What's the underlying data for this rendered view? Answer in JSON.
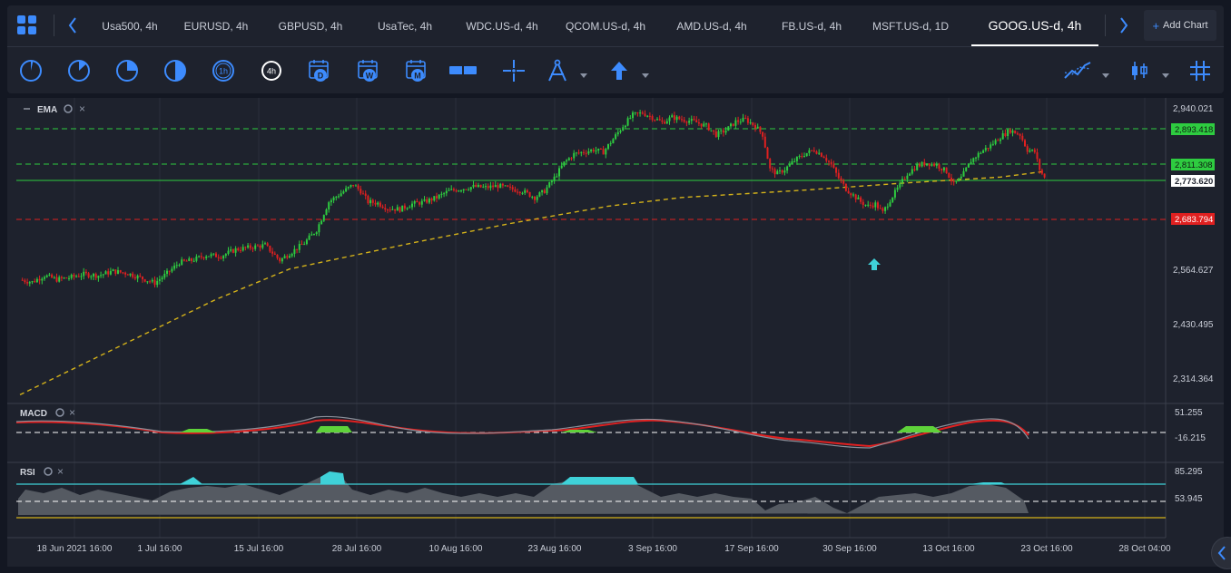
{
  "tabs": [
    {
      "label": "Usa500, 4h",
      "active": false
    },
    {
      "label": "EURUSD, 4h",
      "active": false
    },
    {
      "label": "GBPUSD, 4h",
      "active": false
    },
    {
      "label": "UsaTec, 4h",
      "active": false
    },
    {
      "label": "WDC.US-d, 4h",
      "active": false
    },
    {
      "label": "QCOM.US-d, 4h",
      "active": false
    },
    {
      "label": "AMD.US-d, 4h",
      "active": false
    },
    {
      "label": "FB.US-d, 4h",
      "active": false
    },
    {
      "label": "MSFT.US-d, 1D",
      "active": false
    },
    {
      "label": "GOOG.US-d, 4h",
      "active": true
    }
  ],
  "add_chart_label": "Add Chart",
  "timeframes": {
    "h1": "1h",
    "h4": "4h",
    "day": "D",
    "week": "W",
    "month": "M"
  },
  "colors": {
    "accent": "#3d8bfd",
    "up": "#2ecc40",
    "down": "#e02020",
    "ema": "#d4b21a",
    "rsi_fill": "#555a62",
    "rsi_peak": "#3fd1d8"
  },
  "price_panel": {
    "indicator_label": "EMA",
    "axis_labels": [
      "2,940.021",
      "2,564.627",
      "2,430.495",
      "2,314.364"
    ],
    "levels": [
      {
        "value": "2,893.418",
        "kind": "green"
      },
      {
        "value": "2,811.308",
        "kind": "green"
      },
      {
        "value": "2,773.620",
        "kind": "current"
      },
      {
        "value": "2,683.794",
        "kind": "red"
      }
    ]
  },
  "macd_panel": {
    "label": "MACD",
    "axis_labels": [
      "51.255",
      "-16.215"
    ]
  },
  "rsi_panel": {
    "label": "RSI",
    "axis_labels": [
      "85.295",
      "53.945"
    ]
  },
  "x_axis": [
    "18 Jun 2021 16:00",
    "1 Jul 16:00",
    "15 Jul 16:00",
    "28 Jul 16:00",
    "10 Aug 16:00",
    "23 Aug 16:00",
    "3 Sep 16:00",
    "17 Sep 16:00",
    "30 Sep 16:00",
    "13 Oct 16:00",
    "23 Oct 16:00",
    "28 Oct 04:00"
  ],
  "price_path": [
    [
      0,
      2535
    ],
    [
      5,
      2530
    ],
    [
      10,
      2545
    ],
    [
      15,
      2536
    ],
    [
      20,
      2540
    ],
    [
      26,
      2548
    ],
    [
      32,
      2545
    ],
    [
      38,
      2555
    ],
    [
      44,
      2550
    ],
    [
      50,
      2538
    ],
    [
      55,
      2528
    ],
    [
      60,
      2550
    ],
    [
      65,
      2575
    ],
    [
      70,
      2580
    ],
    [
      76,
      2592
    ],
    [
      82,
      2590
    ],
    [
      88,
      2605
    ],
    [
      94,
      2610
    ],
    [
      100,
      2615
    ],
    [
      106,
      2580
    ],
    [
      111,
      2600
    ],
    [
      116,
      2620
    ],
    [
      121,
      2650
    ],
    [
      126,
      2715
    ],
    [
      131,
      2735
    ],
    [
      136,
      2755
    ],
    [
      139,
      2740
    ],
    [
      142,
      2715
    ],
    [
      146,
      2712
    ],
    [
      150,
      2700
    ],
    [
      155,
      2698
    ],
    [
      160,
      2710
    ],
    [
      165,
      2715
    ],
    [
      170,
      2725
    ],
    [
      175,
      2740
    ],
    [
      180,
      2745
    ],
    [
      185,
      2750
    ],
    [
      190,
      2748
    ],
    [
      195,
      2752
    ],
    [
      200,
      2745
    ],
    [
      205,
      2740
    ],
    [
      210,
      2725
    ],
    [
      214,
      2740
    ],
    [
      218,
      2770
    ],
    [
      222,
      2805
    ],
    [
      226,
      2825
    ],
    [
      230,
      2830
    ],
    [
      234,
      2835
    ],
    [
      238,
      2830
    ],
    [
      242,
      2860
    ],
    [
      246,
      2890
    ],
    [
      250,
      2915
    ],
    [
      254,
      2920
    ],
    [
      258,
      2910
    ],
    [
      262,
      2898
    ],
    [
      266,
      2910
    ],
    [
      270,
      2905
    ],
    [
      275,
      2900
    ],
    [
      280,
      2890
    ],
    [
      284,
      2870
    ],
    [
      288,
      2880
    ],
    [
      292,
      2900
    ],
    [
      296,
      2905
    ],
    [
      300,
      2890
    ],
    [
      303,
      2870
    ],
    [
      306,
      2790
    ],
    [
      309,
      2780
    ],
    [
      312,
      2790
    ],
    [
      316,
      2810
    ],
    [
      320,
      2825
    ],
    [
      324,
      2835
    ],
    [
      328,
      2820
    ],
    [
      331,
      2800
    ],
    [
      334,
      2770
    ],
    [
      337,
      2745
    ],
    [
      340,
      2730
    ],
    [
      343,
      2715
    ],
    [
      346,
      2705
    ],
    [
      349,
      2710
    ],
    [
      352,
      2690
    ],
    [
      355,
      2720
    ],
    [
      358,
      2745
    ],
    [
      362,
      2780
    ],
    [
      366,
      2798
    ],
    [
      370,
      2805
    ],
    [
      374,
      2800
    ],
    [
      378,
      2785
    ],
    [
      381,
      2755
    ],
    [
      384,
      2770
    ],
    [
      388,
      2810
    ],
    [
      392,
      2830
    ],
    [
      396,
      2845
    ],
    [
      400,
      2865
    ],
    [
      404,
      2880
    ],
    [
      408,
      2870
    ],
    [
      411,
      2835
    ],
    [
      414,
      2830
    ],
    [
      416,
      2790
    ],
    [
      418,
      2770
    ]
  ],
  "ema_path": [
    [
      0,
      2270
    ],
    [
      40,
      2380
    ],
    [
      80,
      2490
    ],
    [
      110,
      2560
    ],
    [
      160,
      2620
    ],
    [
      200,
      2665
    ],
    [
      240,
      2705
    ],
    [
      270,
      2725
    ],
    [
      300,
      2735
    ],
    [
      320,
      2742
    ],
    [
      340,
      2750
    ],
    [
      360,
      2758
    ],
    [
      380,
      2765
    ],
    [
      400,
      2772
    ],
    [
      418,
      2785
    ]
  ]
}
